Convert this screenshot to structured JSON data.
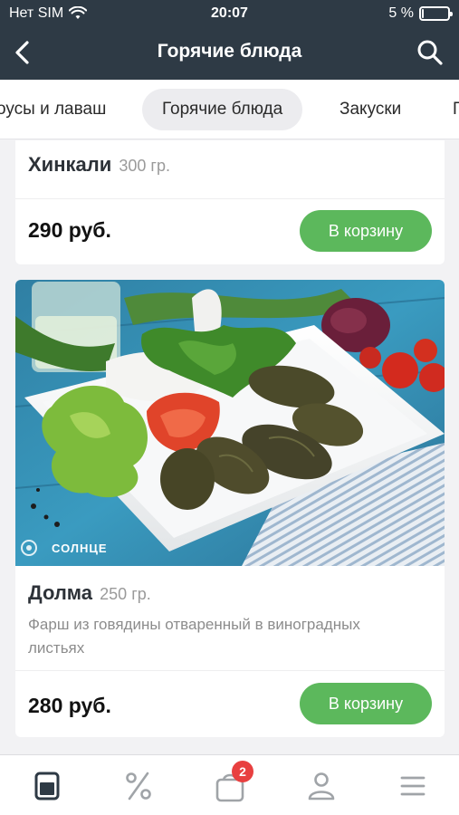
{
  "status_bar": {
    "carrier": "Нет SIM",
    "time": "20:07",
    "battery_text": "5 %",
    "battery_level": 0.05
  },
  "nav": {
    "title": "Горячие блюда",
    "back_icon": "chevron-left-icon",
    "search_icon": "search-icon"
  },
  "tabs": [
    {
      "label": "оусы и лаваш",
      "active": false
    },
    {
      "label": "Горячие блюда",
      "active": true
    },
    {
      "label": "Закуски",
      "active": false
    },
    {
      "label": "П",
      "active": false
    }
  ],
  "products": [
    {
      "name": "Хинкали",
      "weight": "300 гр.",
      "price": "290 руб.",
      "button": "В корзину"
    },
    {
      "name": "Долма",
      "weight": "250 гр.",
      "description": "Фарш из говядины отваренный в виноградных листьях",
      "price": "280 руб.",
      "button": "В корзину",
      "watermark": "СОЛНЦЕ"
    }
  ],
  "bottom_bar": {
    "items": [
      {
        "icon": "menu-card-icon",
        "active": true
      },
      {
        "icon": "percent-icon",
        "active": false
      },
      {
        "icon": "cart-bag-icon",
        "active": false,
        "badge": "2"
      },
      {
        "icon": "profile-icon",
        "active": false
      },
      {
        "icon": "hamburger-icon",
        "active": false
      }
    ]
  },
  "colors": {
    "header_bg": "#2e3a45",
    "accent_green": "#5cb85c",
    "badge_red": "#e84040"
  }
}
